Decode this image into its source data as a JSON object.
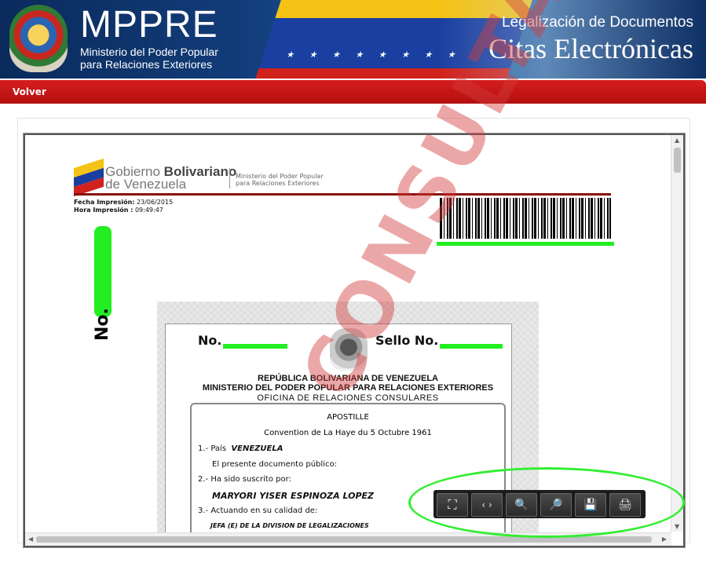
{
  "header": {
    "brand_big": "MPPRE",
    "brand_sub1": "Ministerio del Poder Popular",
    "brand_sub2": "para Relaciones Exteriores",
    "right_line1": "Legalización de Documentos",
    "right_line2": "Citas Electrónicas"
  },
  "nav": {
    "volver_label": "Volver"
  },
  "document": {
    "gob_line1_a": "Gobierno ",
    "gob_line1_b": "Bolivariano",
    "gob_line2": "de Venezuela",
    "ministry_line1": "Ministerio del Poder Popular",
    "ministry_line2": "para Relaciones Exteriores",
    "fecha_label": "Fecha Impresión:",
    "fecha_value": "23/06/2015",
    "hora_label": "Hora Impresión :",
    "hora_value": "09:49:47",
    "vertical_no": "No.",
    "apostille": {
      "no_label": "No.",
      "sello_label": "Sello No.",
      "republic": "REPÚBLICA BOLIVARIANA DE VENEZUELA",
      "ministry": "MINISTERIO DEL PODER POPULAR PARA RELACIONES EXTERIORES",
      "office": "OFICINA DE RELACIONES CONSULARES",
      "title": "APOSTILLE",
      "convention": "Convention de La Haye du 5 Octubre 1961",
      "l1_label": "1.- País",
      "l1_value": "VENEZUELA",
      "l1b": "El presente documento público:",
      "l2_label": "2.- Ha sido suscrito por:",
      "l2_value": "MARYORI YISER ESPINOZA LOPEZ",
      "l3_label": "3.- Actuando en su calidad de:",
      "l3_value": "JEFA (E) DE LA DIVISION DE LEGALIZACIONES"
    },
    "watermark": "CONSULTA"
  },
  "toolbar": {
    "buttons": [
      {
        "icon": "fit-page-icon",
        "glyph": "⛶"
      },
      {
        "icon": "fit-width-icon",
        "glyph": "‹ ›"
      },
      {
        "icon": "zoom-out-icon",
        "glyph": "🔍"
      },
      {
        "icon": "zoom-in-icon",
        "glyph": "🔎"
      },
      {
        "icon": "save-icon",
        "glyph": "💾"
      },
      {
        "icon": "print-icon",
        "glyph": "🖨"
      }
    ]
  },
  "colors": {
    "red_bar": "#c41414",
    "highlight_green": "#22ee22",
    "header_blue": "#123d7a"
  }
}
